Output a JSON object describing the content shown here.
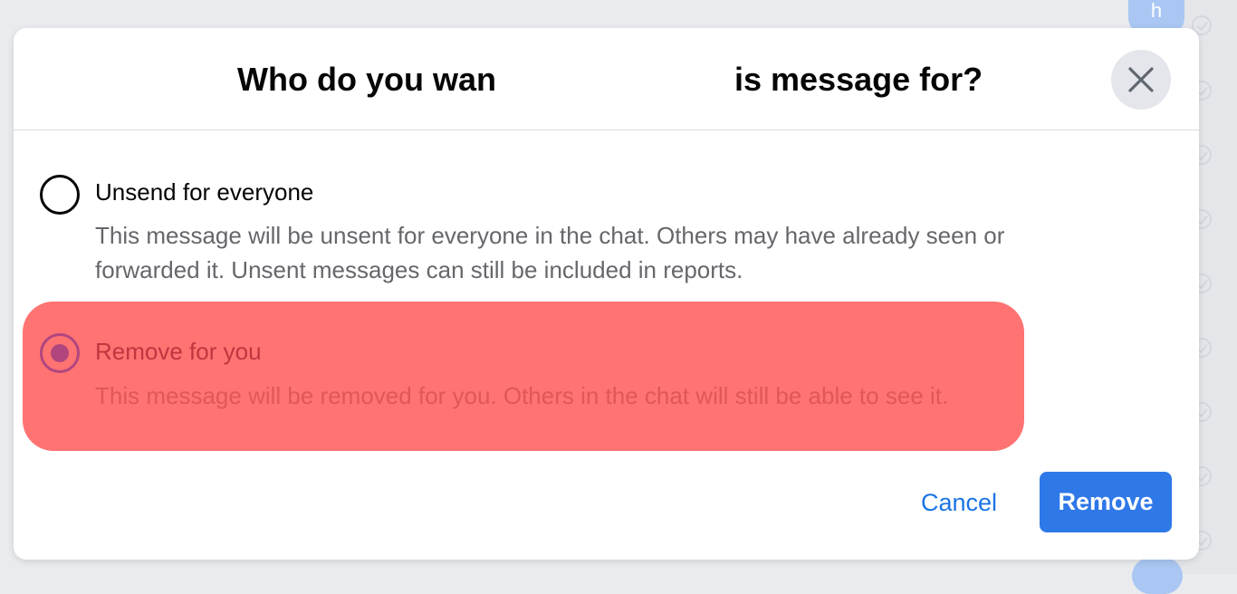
{
  "background": {
    "avatar_letter": "h"
  },
  "dialog": {
    "title_visible_left": "Who do you wan",
    "title_visible_right": "is message for?",
    "options": [
      {
        "label": "Unsend for everyone",
        "description": "This message will be unsent for everyone in the chat. Others may have already seen or forwarded it. Unsent messages can still be included in reports.",
        "selected": false
      },
      {
        "label": "Remove for you",
        "description": "This message will be removed for you. Others in the chat will still be able to see it.",
        "selected": true
      }
    ],
    "cancel_label": "Cancel",
    "remove_label": "Remove"
  },
  "colors": {
    "primary": "#1b74e4",
    "primary_button": "#2f78e8",
    "highlight": "#ff7373",
    "radio_selected": "#b1467e"
  },
  "icons": {
    "close": "close-icon",
    "checkmark": "check-circle-icon"
  }
}
